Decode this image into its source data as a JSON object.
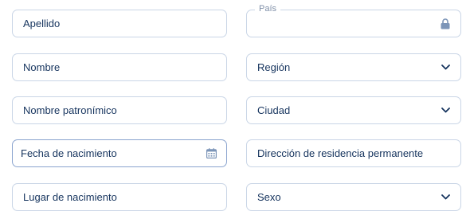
{
  "form": {
    "left": {
      "surname": {
        "value": "Apellido"
      },
      "name": {
        "value": "Nombre"
      },
      "patronymic": {
        "value": "Nombre patronímico"
      },
      "birth_date": {
        "value": "Fecha de nacimiento",
        "icon": "calendar-icon"
      },
      "birth_place": {
        "value": "Lugar de nacimiento"
      }
    },
    "right": {
      "country": {
        "label": "País",
        "value": "",
        "icon": "lock-icon",
        "locked": true
      },
      "region": {
        "value": "Región",
        "icon": "chevron-down-icon"
      },
      "city": {
        "value": "Ciudad",
        "icon": "chevron-down-icon"
      },
      "residence": {
        "value": "Dirección de residencia permanente"
      },
      "sex": {
        "value": "Sexo",
        "icon": "chevron-down-icon"
      }
    }
  },
  "colors": {
    "border": "#c9d5e6",
    "border_active": "#8aa4cf",
    "text": "#16345e",
    "label": "#7f8fa8",
    "icon": "#7c95b8"
  }
}
